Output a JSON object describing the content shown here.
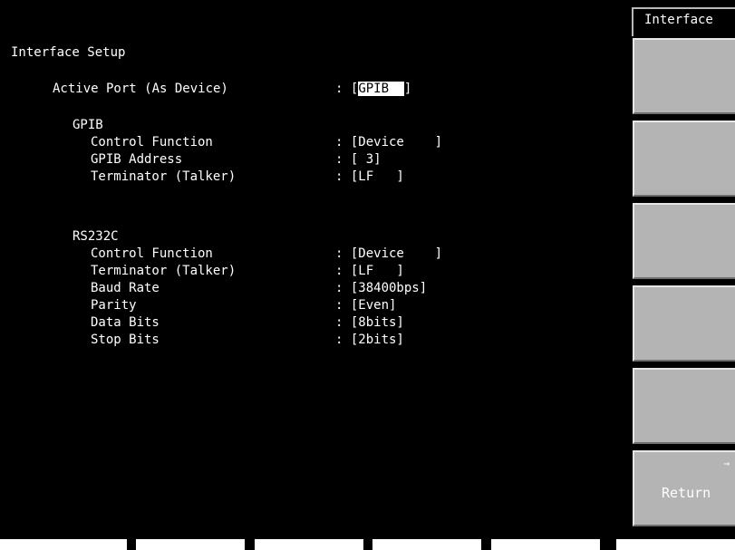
{
  "screen": {
    "menu_title": "Interface",
    "title": "Interface Setup",
    "active_port": {
      "label": "Active Port (As Device)",
      "separator": ":",
      "open": "[",
      "value": "GPIB  ",
      "close": "]"
    },
    "gpib": {
      "heading": "GPIB",
      "rows": [
        {
          "label": "Control Function",
          "value": ": [Device    ]"
        },
        {
          "label": "GPIB Address",
          "value": ": [ 3]"
        },
        {
          "label": "Terminator (Talker)",
          "value": ": [LF   ]"
        }
      ]
    },
    "rs232c": {
      "heading": "RS232C",
      "rows": [
        {
          "label": "Control Function",
          "value": ": [Device    ]"
        },
        {
          "label": "Terminator (Talker)",
          "value": ": [LF   ]"
        },
        {
          "label": "Baud Rate",
          "value": ": [38400bps]"
        },
        {
          "label": "Parity",
          "value": ": [Even]"
        },
        {
          "label": "Data Bits",
          "value": ": [8bits]"
        },
        {
          "label": "Stop Bits",
          "value": ": [2bits]"
        }
      ]
    }
  },
  "softkeys": {
    "key6": {
      "label": "Return",
      "arrow": "→"
    }
  },
  "colors": {
    "screen_bg": "#000000",
    "text": "#ffffff",
    "softkey_bg": "#b4b4b4",
    "highlight_bg": "#ffffff"
  }
}
